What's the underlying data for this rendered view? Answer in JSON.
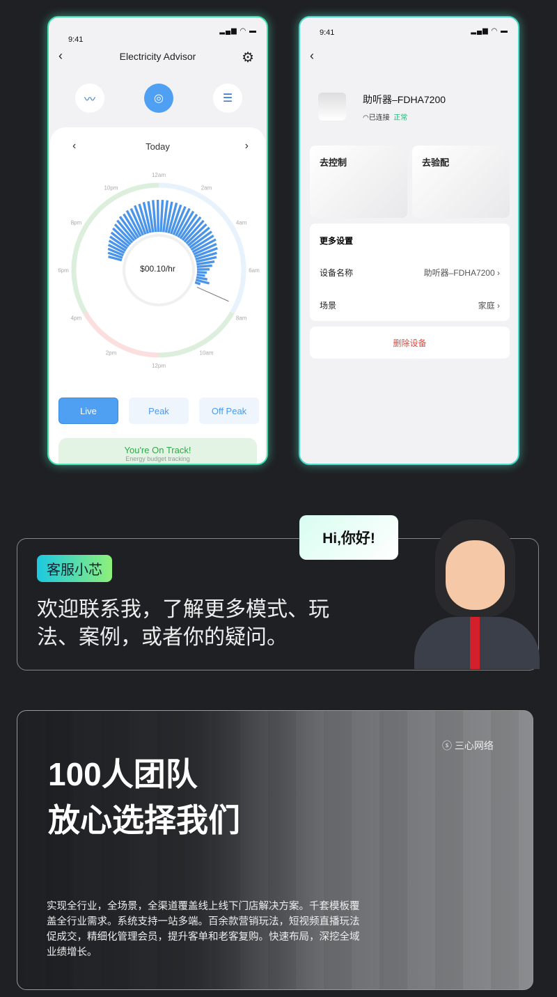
{
  "phone1": {
    "time": "9:41",
    "status_icons": "signal wifi battery",
    "title": "Electricity Advisor",
    "nav_label": "Today",
    "center_value": "$00.10/hr",
    "clock_labels": [
      "12am",
      "2am",
      "4am",
      "6am",
      "8am",
      "10am",
      "12pm",
      "2pm",
      "4pm",
      "6pm",
      "8pm",
      "10pm"
    ],
    "ring_colors": {
      "green": "#dcefdc",
      "blue": "#e8f2fc",
      "red": "#fbdede"
    },
    "bar_color": "#4a94ea",
    "usage_bars": [
      20,
      22,
      24,
      26,
      28,
      30,
      32,
      34,
      36,
      38,
      40,
      40,
      42,
      42,
      44,
      44,
      45,
      45,
      46,
      46,
      46,
      46,
      45,
      45,
      44,
      44,
      44,
      43,
      42,
      42,
      41,
      40,
      40,
      39,
      38,
      38,
      36,
      35,
      32,
      30,
      26,
      22,
      18,
      14,
      12,
      16,
      20,
      8
    ],
    "segments": [
      "Live",
      "Peak",
      "Off Peak"
    ],
    "active_segment": "Live",
    "track_title": "You're On Track!",
    "track_sub": "Energy budget tracking"
  },
  "phone2": {
    "time": "9:41",
    "device_name": "助听器–FDHA7200",
    "conn": "已连接",
    "state": "正常",
    "tile1": "去控制",
    "tile2": "去验配",
    "more_title": "更多设置",
    "rows": [
      {
        "label": "设备名称",
        "value": "助听器–FDHA7200"
      },
      {
        "label": "场景",
        "value": "家庭"
      }
    ],
    "delete": "删除设备"
  },
  "service": {
    "badge": "客服小芯",
    "bubble": "Hi,你好!",
    "text1": "欢迎联系我，了解更多模式、玩",
    "text2": "法、案例，或者你的疑问。"
  },
  "team": {
    "h1": "100人团队",
    "h2": "放心选择我们",
    "logo": "三心网络 SANXIN NETWORK",
    "lines": [
      "实现全行业，全场景，全渠道覆盖线上线下门店解决方案。千套模板覆",
      "盖全行业需求。系统支持一站多端。百余款营销玩法，短视频直播玩法",
      "促成交，精细化管理会员，提升客单和老客复购。快速布局，深挖全域",
      "业绩增长。"
    ]
  }
}
